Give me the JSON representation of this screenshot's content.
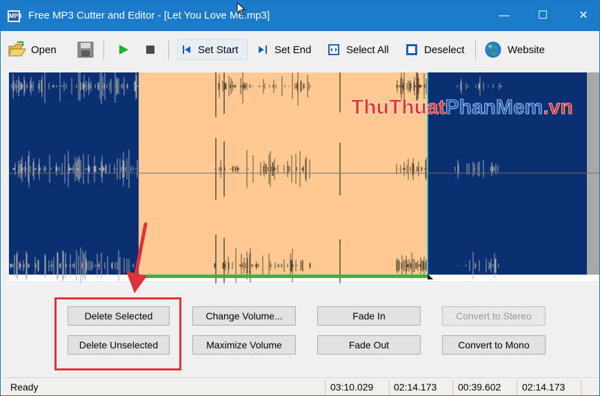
{
  "window": {
    "title": "Free MP3 Cutter and Editor - [Let You Love Me.mp3]",
    "icon_label": "MP3",
    "minimize_glyph": "—",
    "maximize_glyph": "☐",
    "close_glyph": "✕"
  },
  "toolbar": {
    "open_label": "Open",
    "set_start_label": "Set Start",
    "set_end_label": "Set End",
    "select_all_label": "Select All",
    "deselect_label": "Deselect",
    "website_label": "Website"
  },
  "waveform": {
    "watermark_part1": "ThuThuat",
    "watermark_part2": "PhanMem",
    "watermark_part3": ".vn",
    "colors": {
      "unselected": "#0b2f73",
      "selected": "#fec993",
      "wave_selected": "#5a4a32",
      "progress": "#3cb043"
    }
  },
  "actions": {
    "delete_selected": "Delete Selected",
    "delete_unselected": "Delete Unselected",
    "change_volume": "Change Volume...",
    "maximize_volume": "Maximize Volume",
    "fade_in": "Fade In",
    "fade_out": "Fade Out",
    "convert_to_stereo": "Convert to Stereo",
    "convert_to_mono": "Convert to Mono"
  },
  "status": {
    "state": "Ready",
    "total_length": "03:10.029",
    "selection_start": "02:14.173",
    "selection_length": "00:39.602",
    "cursor_position": "02:14.173"
  }
}
